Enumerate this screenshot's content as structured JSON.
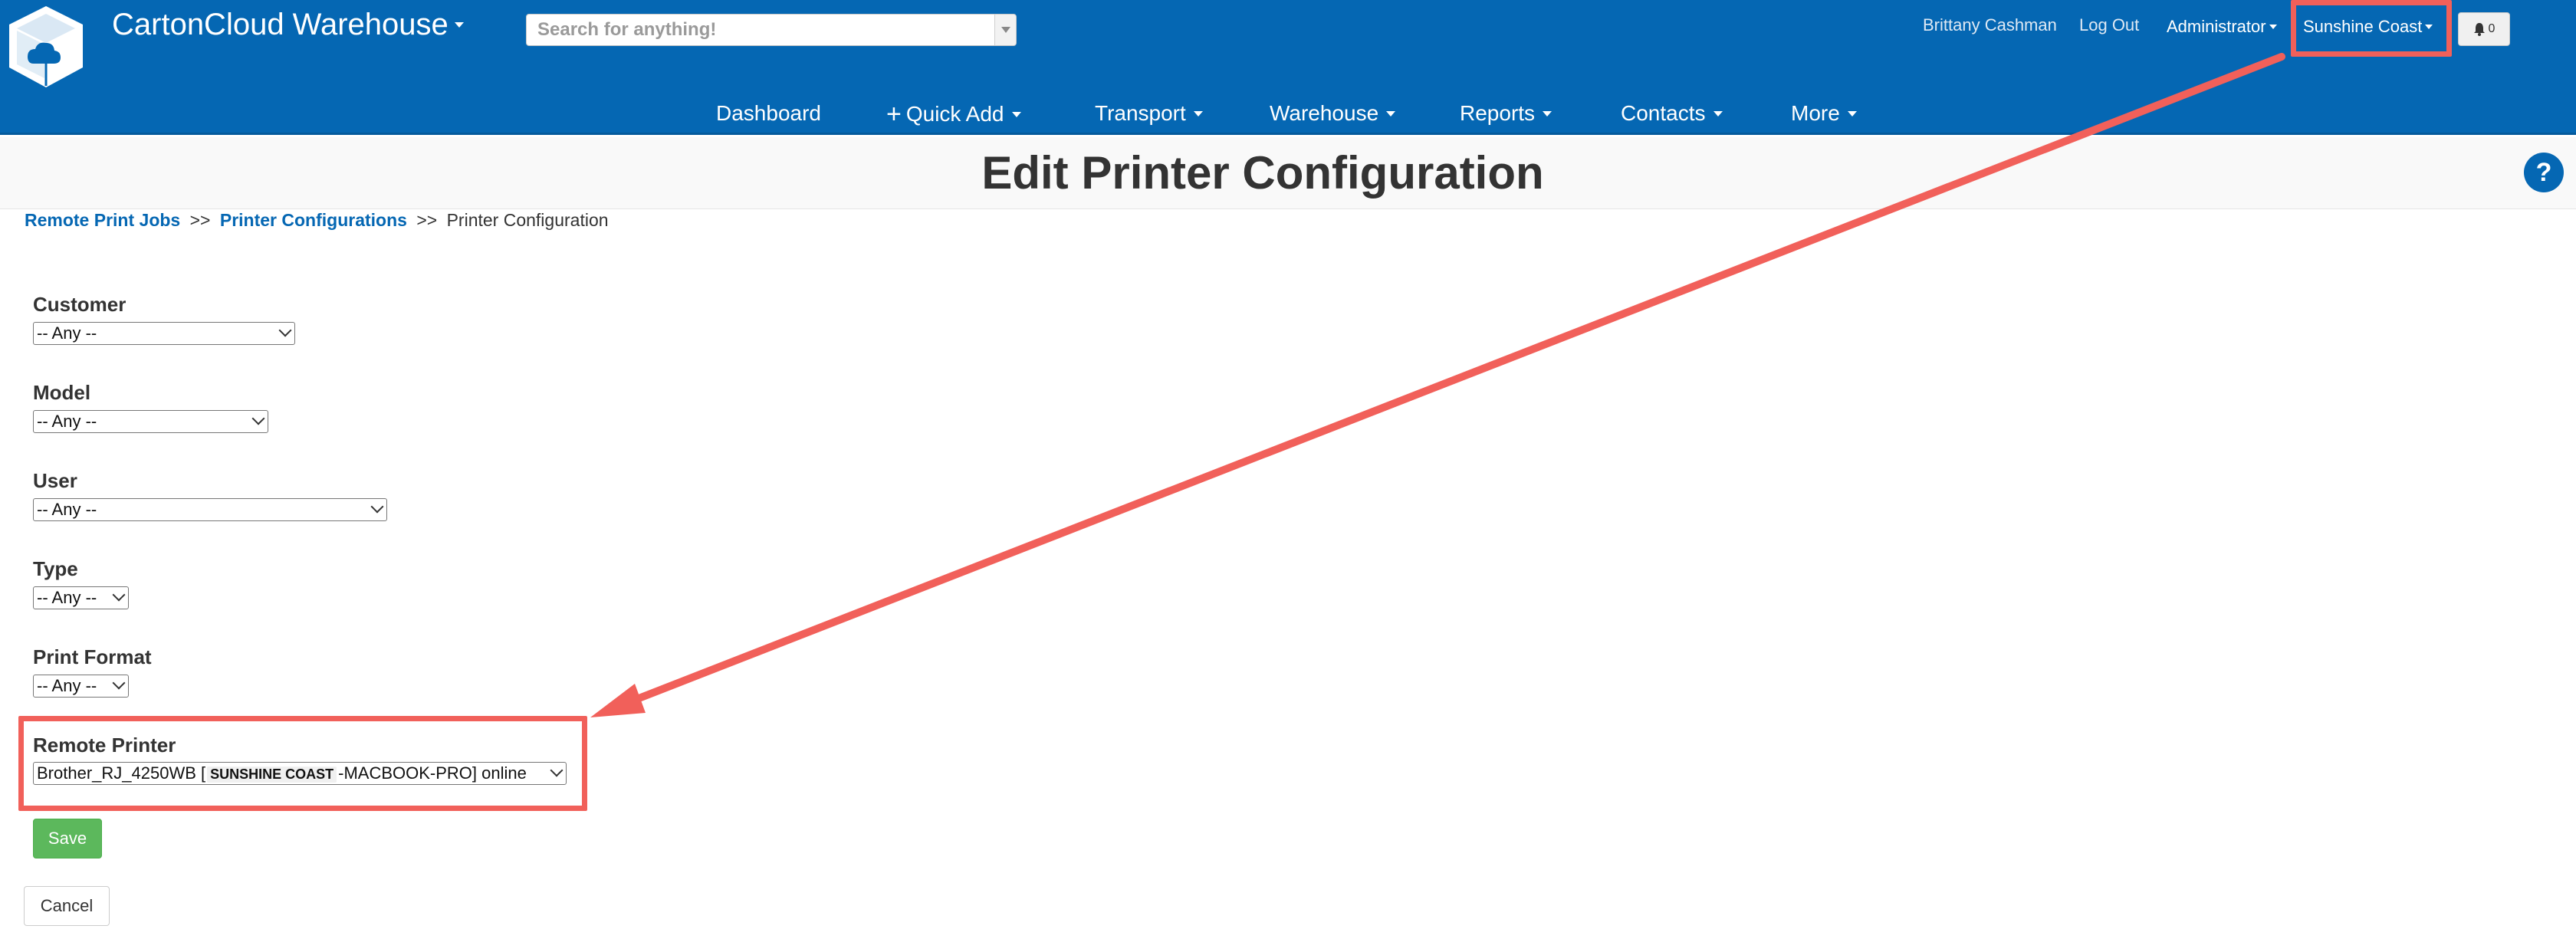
{
  "app": {
    "title": "CartonCloud Warehouse"
  },
  "search": {
    "placeholder": "Search for anything!"
  },
  "header": {
    "user": "Brittany Cashman",
    "logout": "Log Out",
    "role": "Administrator",
    "location": "Sunshine Coast",
    "notifications": "0"
  },
  "nav": {
    "dashboard": "Dashboard",
    "quick_add": "Quick Add",
    "transport": "Transport",
    "warehouse": "Warehouse",
    "reports": "Reports",
    "contacts": "Contacts",
    "more": "More"
  },
  "page": {
    "title": "Edit Printer Configuration",
    "help": "?"
  },
  "breadcrumb": {
    "item1": "Remote Print Jobs",
    "sep": ">>",
    "item2": "Printer Configurations",
    "current": "Printer Configuration"
  },
  "form": {
    "customer": {
      "label": "Customer",
      "value": "-- Any --"
    },
    "model": {
      "label": "Model",
      "value": "-- Any --"
    },
    "user": {
      "label": "User",
      "value": "-- Any --"
    },
    "type": {
      "label": "Type",
      "value": "-- Any --"
    },
    "print_format": {
      "label": "Print Format",
      "value": "-- Any --"
    },
    "remote_printer": {
      "label": "Remote Printer",
      "value_prefix": "Brother_RJ_4250WB [",
      "value_badge": "SUNSHINE COAST",
      "value_suffix": "-MACBOOK-PRO] online"
    },
    "save": "Save",
    "cancel": "Cancel"
  },
  "colors": {
    "header_bg": "#0567b3",
    "annotation": "#f1605a",
    "save_bg": "#5cb85c"
  }
}
